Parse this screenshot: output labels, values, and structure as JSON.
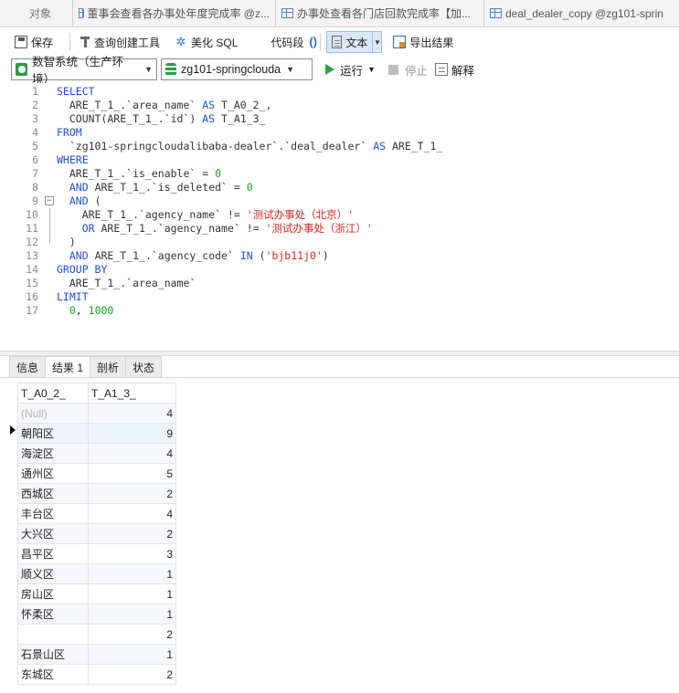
{
  "tabs": {
    "object": "对象",
    "t1": "董事会查看各办事处年度完成率 @z...",
    "t2": "办事处查看各门店回款完成率【加...",
    "t3": "deal_dealer_copy @zg101-sprin"
  },
  "toolbar": {
    "save": "保存",
    "query_builder": "查询创建工具",
    "beautify": "美化 SQL",
    "code_snippet": "代码段",
    "text": "文本",
    "export": "导出结果"
  },
  "toolbar2": {
    "connection": "数智系统（生产环境）",
    "schema": "zg101-springclouda",
    "run": "运行",
    "stop": "停止",
    "explain": "解释"
  },
  "sql_lines": [
    {
      "n": "1",
      "html": "<span class=\"kw\">SELECT</span>"
    },
    {
      "n": "2",
      "html": "  ARE_T_1_.`area_name` <span class=\"kw\">AS</span> T_A0_2_,"
    },
    {
      "n": "3",
      "html": "  COUNT(ARE_T_1_.`id`) <span class=\"kw\">AS</span> T_A1_3_"
    },
    {
      "n": "4",
      "html": "<span class=\"kw\">FROM</span>"
    },
    {
      "n": "5",
      "html": "  `zg101-springcloudalibaba-dealer`.`deal_dealer` <span class=\"kw\">AS</span> ARE_T_1_"
    },
    {
      "n": "6",
      "html": "<span class=\"kw\">WHERE</span>"
    },
    {
      "n": "7",
      "html": "  ARE_T_1_.`is_enable` = <span class=\"num\">0</span>"
    },
    {
      "n": "8",
      "html": "  <span class=\"kw\">AND</span> ARE_T_1_.`is_deleted` = <span class=\"num\">0</span>"
    },
    {
      "n": "9",
      "html": "  <span class=\"kw\">AND</span> ("
    },
    {
      "n": "10",
      "html": "    ARE_T_1_.`agency_name` != <span class=\"str\">'测试办事处（北京）'</span>"
    },
    {
      "n": "11",
      "html": "    <span class=\"kw\">OR</span> ARE_T_1_.`agency_name` != <span class=\"str\">'测试办事处（浙江）'</span>"
    },
    {
      "n": "12",
      "html": "  )"
    },
    {
      "n": "13",
      "html": "  <span class=\"kw\">AND</span> ARE_T_1_.`agency_code` <span class=\"kw\">IN</span> (<span class=\"str\">'bjb11j0'</span>)"
    },
    {
      "n": "14",
      "html": "<span class=\"kw\">GROUP BY</span>"
    },
    {
      "n": "15",
      "html": "  ARE_T_1_.`area_name`"
    },
    {
      "n": "16",
      "html": "<span class=\"kw\">LIMIT</span>"
    },
    {
      "n": "17",
      "html": "  <span class=\"num\">0</span>, <span class=\"num\">1000</span>"
    }
  ],
  "result_tabs": [
    "信息",
    "结果 1",
    "剖析",
    "状态"
  ],
  "result_active_tab": 1,
  "grid": {
    "columns": [
      "T_A0_2_",
      "T_A1_3_"
    ],
    "rows": [
      [
        "(Null)",
        "4"
      ],
      [
        "朝阳区",
        "9"
      ],
      [
        "海淀区",
        "4"
      ],
      [
        "通州区",
        "5"
      ],
      [
        "西城区",
        "2"
      ],
      [
        "丰台区",
        "4"
      ],
      [
        "大兴区",
        "2"
      ],
      [
        "昌平区",
        "3"
      ],
      [
        "顺义区",
        "1"
      ],
      [
        "房山区",
        "1"
      ],
      [
        "怀柔区",
        "1"
      ],
      [
        "",
        "2"
      ],
      [
        "石景山区",
        "1"
      ],
      [
        "东城区",
        "2"
      ]
    ],
    "selected_row": 1
  }
}
